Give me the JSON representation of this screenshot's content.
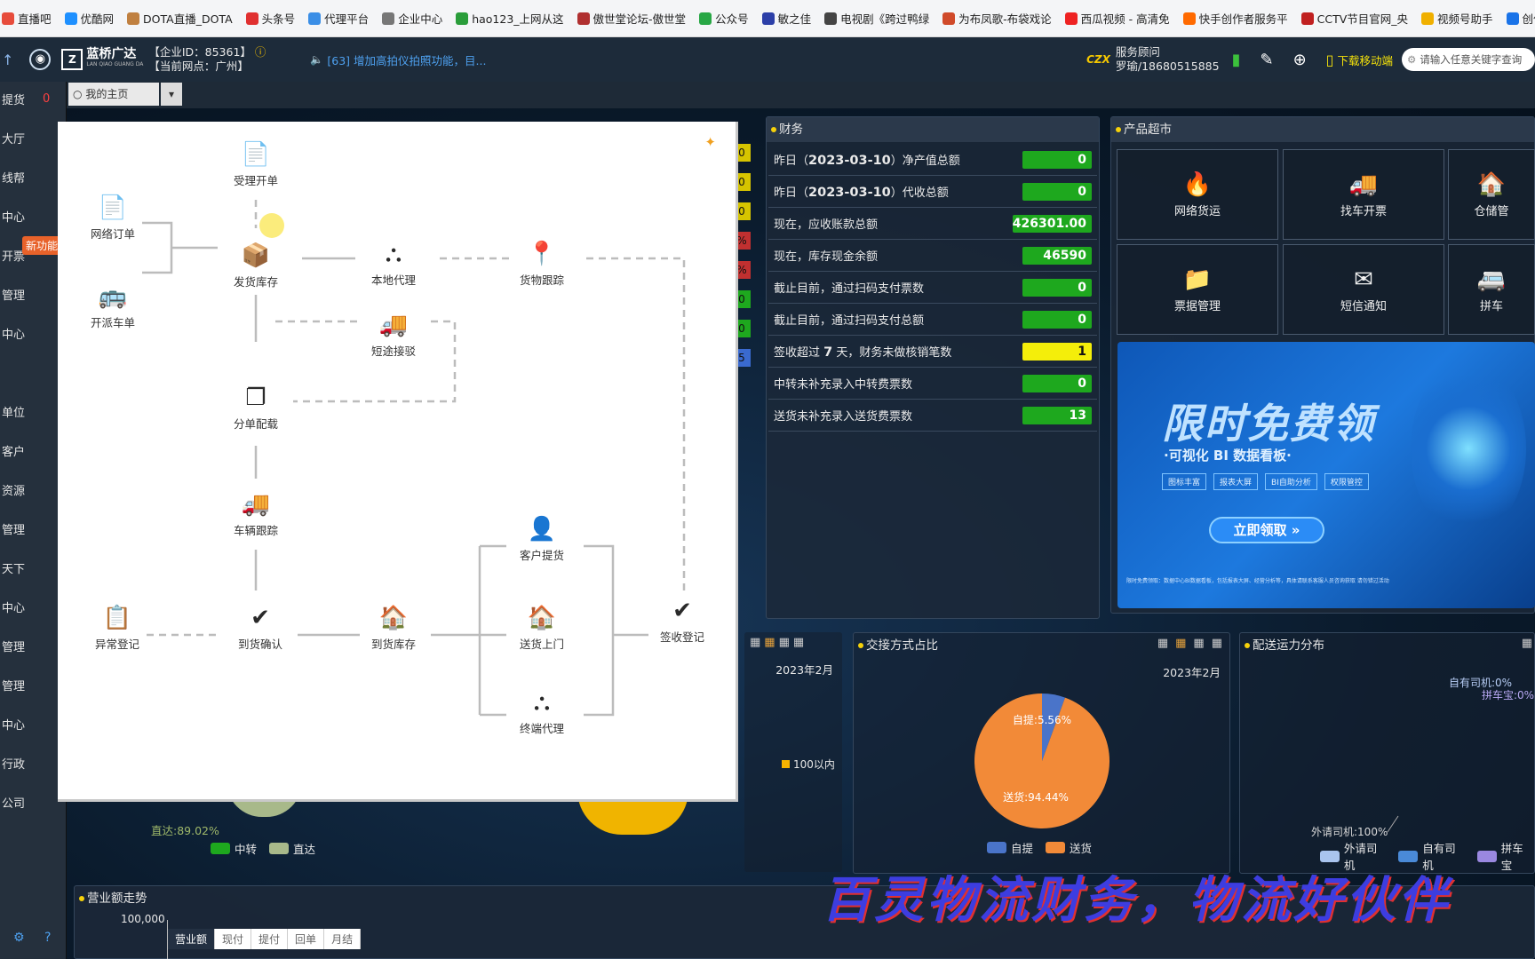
{
  "bookmarks": [
    {
      "label": "直播吧",
      "color": "#e74c3c"
    },
    {
      "label": "优酷网",
      "color": "#1e90ff"
    },
    {
      "label": "DOTA直播_DOTA",
      "color": "#c08040"
    },
    {
      "label": "头条号",
      "color": "#e03030"
    },
    {
      "label": "代理平台",
      "color": "#3a8ee6"
    },
    {
      "label": "企业中心",
      "color": "#777777"
    },
    {
      "label": "hao123_上网从这",
      "color": "#2a9d3a"
    },
    {
      "label": "傲世堂论坛-傲世堂",
      "color": "#b03030"
    },
    {
      "label": "公众号",
      "color": "#28a745"
    },
    {
      "label": "敏之佳",
      "color": "#2c3fa8"
    },
    {
      "label": "电视剧《跨过鸭绿",
      "color": "#444444"
    },
    {
      "label": "为布凤歌-布袋戏论",
      "color": "#d04a2a"
    },
    {
      "label": "西瓜视频 - 高清免",
      "color": "#e22"
    },
    {
      "label": "快手创作者服务平",
      "color": "#ff6a00"
    },
    {
      "label": "CCTV节目官网_央",
      "color": "#c02020"
    },
    {
      "label": "视频号助手",
      "color": "#f0b000"
    },
    {
      "label": "创作中心",
      "color": "#1a73e8"
    }
  ],
  "header": {
    "logo_text": "蓝桥广达",
    "logo_sub": "LAN QIAO GUANG DA",
    "company_id": "【企业ID：85361】",
    "branch": "【当前网点：广州】",
    "notice": "[63]  增加高拍仪拍照功能，目...",
    "advisor_label": "服务顾问",
    "advisor_contact": "罗瑜/18680515885",
    "mobile": "下载移动端",
    "search_placeholder": "请输入任意关键字查询"
  },
  "sidebar": [
    "提货",
    "大厅",
    "线帮",
    "中心",
    "开票",
    "管理",
    "中心",
    "",
    "单位",
    "客户",
    "资源",
    "管理",
    "天下",
    "中心",
    "管理",
    "管理",
    "中心",
    "行政",
    "公司"
  ],
  "sidebar_badge": "0",
  "new_feature": "新功能",
  "tabs": {
    "home": "我的主页"
  },
  "finance": {
    "title": "财务",
    "rows": [
      {
        "pre": "昨日（",
        "date": "2023-03-10",
        "post": "）净产值总额",
        "value": "0",
        "color": "green"
      },
      {
        "pre": "昨日（",
        "date": "2023-03-10",
        "post": "）代收总额",
        "value": "0",
        "color": "green"
      },
      {
        "pre": "现在，应收账款总额",
        "date": "",
        "post": "",
        "value": "426301.00",
        "color": "green"
      },
      {
        "pre": "现在，库存现金余额",
        "date": "",
        "post": "",
        "value": "46590",
        "color": "green"
      },
      {
        "pre": "截止目前，通过扫码支付票数",
        "date": "",
        "post": "",
        "value": "0",
        "color": "green"
      },
      {
        "pre": "截止目前，通过扫码支付总额",
        "date": "",
        "post": "",
        "value": "0",
        "color": "green"
      },
      {
        "pre": "签收超过 ",
        "date": "7",
        "post": " 天，财务未做核销笔数",
        "value": "1",
        "color": "yellow"
      },
      {
        "pre": "中转未补充录入中转费票数",
        "date": "",
        "post": "",
        "value": "0",
        "color": "green"
      },
      {
        "pre": "送货未补充录入送货费票数",
        "date": "",
        "post": "",
        "value": "13",
        "color": "green"
      }
    ]
  },
  "left_strip": [
    "0",
    "0",
    "0",
    "%",
    "%",
    "0",
    "0",
    "5"
  ],
  "market": {
    "title": "产品超市",
    "tiles": [
      {
        "label": "网络货运",
        "icon": "🔥"
      },
      {
        "label": "找车开票",
        "icon": "🚚"
      },
      {
        "label": "仓储管",
        "icon": "🏠"
      },
      {
        "label": "票据管理",
        "icon": "📁"
      },
      {
        "label": "短信通知",
        "icon": "✉"
      },
      {
        "label": "拼车",
        "icon": "🚐"
      }
    ]
  },
  "banner": {
    "title": "限时免费领",
    "subtitle": "·可视化 BI 数据看板·",
    "tags": [
      "图标丰富",
      "报表大屏",
      "BI自助分析",
      "权限管控"
    ],
    "cta": "立即领取 »",
    "fine_print": "限时免费领取：数据中心BI数据看板，包括报表大屏、经营分析等，具体请联系客服人员咨询获取 请勿错过活动"
  },
  "flow": {
    "nodes": {
      "accept": "受理开单",
      "net": "网络订单",
      "dispatch": "开派车单",
      "ship": "发货库存",
      "local": "本地代理",
      "track": "货物跟踪",
      "short": "短途接驳",
      "split": "分单配载",
      "vehicle": "车辆跟踪",
      "exception": "异常登记",
      "arrive_confirm": "到货确认",
      "arrive_stock": "到货库存",
      "pickup": "客户提货",
      "delivery": "送货上门",
      "terminal": "终端代理",
      "sign": "签收登记"
    }
  },
  "trade_mode": {
    "title": "交接方式占比",
    "date": "2023年2月",
    "legend": [
      "自提",
      "送货"
    ],
    "labels": [
      "自提:5.56%",
      "送货:94.44%"
    ]
  },
  "capacity": {
    "title": "配送运力分布",
    "labels": [
      "自有司机:0%",
      "拼车宝:0%",
      "外请司机:100%"
    ],
    "legend": [
      "外请司机",
      "自有司机",
      "拼车宝"
    ]
  },
  "mid": {
    "date": "2023年2月",
    "legend": "100以内"
  },
  "bottom_left": {
    "label": "直达:89.02%",
    "legend": [
      "中转",
      "直达"
    ]
  },
  "revenue": {
    "title": "营业额走势",
    "ytick": "100,000",
    "tabs": [
      "营业额",
      "现付",
      "提付",
      "回单",
      "月结"
    ]
  },
  "slogan": "百灵物流财务，物流好伙伴",
  "chart_data": [
    {
      "type": "pie",
      "title": "交接方式占比",
      "categories": [
        "自提",
        "送货"
      ],
      "values": [
        5.56,
        94.44
      ],
      "colors": [
        "#4a74c9",
        "#f28a38"
      ]
    },
    {
      "type": "pie",
      "title": "配送运力分布",
      "categories": [
        "外请司机",
        "自有司机",
        "拼车宝"
      ],
      "values": [
        100,
        0,
        0
      ],
      "colors": [
        "#a9c4ee",
        "#4a8ad8",
        "#9a88e0"
      ]
    }
  ]
}
